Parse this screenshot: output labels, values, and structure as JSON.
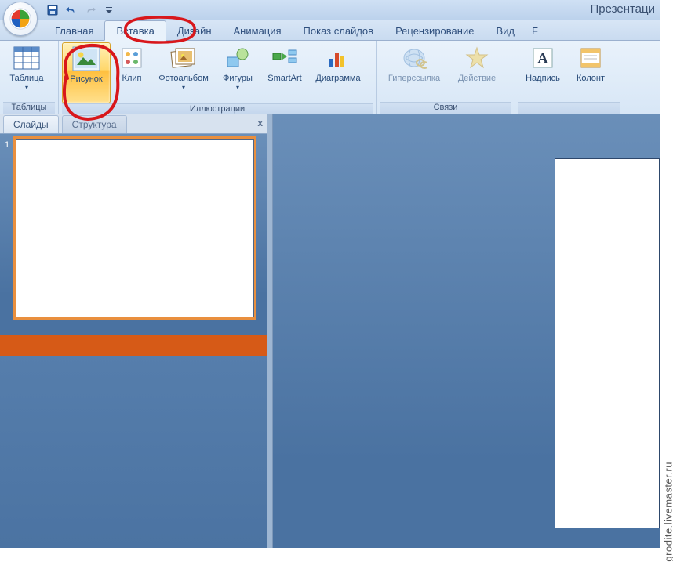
{
  "title_bar": {
    "app_title": "Презентаци"
  },
  "tabs": [
    {
      "label": "Главная"
    },
    {
      "label": "Вставка",
      "active": true
    },
    {
      "label": "Дизайн"
    },
    {
      "label": "Анимация"
    },
    {
      "label": "Показ слайдов"
    },
    {
      "label": "Рецензирование"
    },
    {
      "label": "Вид"
    },
    {
      "label": "F"
    }
  ],
  "ribbon": {
    "groups": [
      {
        "label": "Таблицы",
        "buttons": [
          {
            "label": "Таблица",
            "dropdown": true
          }
        ]
      },
      {
        "label": "Иллюстрации",
        "buttons": [
          {
            "label": "Рисунок",
            "highlighted": true
          },
          {
            "label": "Клип"
          },
          {
            "label": "Фотоальбом",
            "dropdown": true
          },
          {
            "label": "Фигуры",
            "dropdown": true
          },
          {
            "label": "SmartArt"
          },
          {
            "label": "Диаграмма"
          }
        ]
      },
      {
        "label": "Связи",
        "buttons": [
          {
            "label": "Гиперссылка"
          },
          {
            "label": "Действие"
          }
        ]
      },
      {
        "label": "",
        "buttons": [
          {
            "label": "Надпись"
          },
          {
            "label": "Колонт"
          }
        ]
      }
    ]
  },
  "left_pane": {
    "tabs": [
      {
        "label": "Слайды",
        "active": true
      },
      {
        "label": "Структура"
      }
    ],
    "close": "x",
    "slides": [
      {
        "number": "1"
      }
    ]
  },
  "watermark": "grodite.livemaster.ru"
}
